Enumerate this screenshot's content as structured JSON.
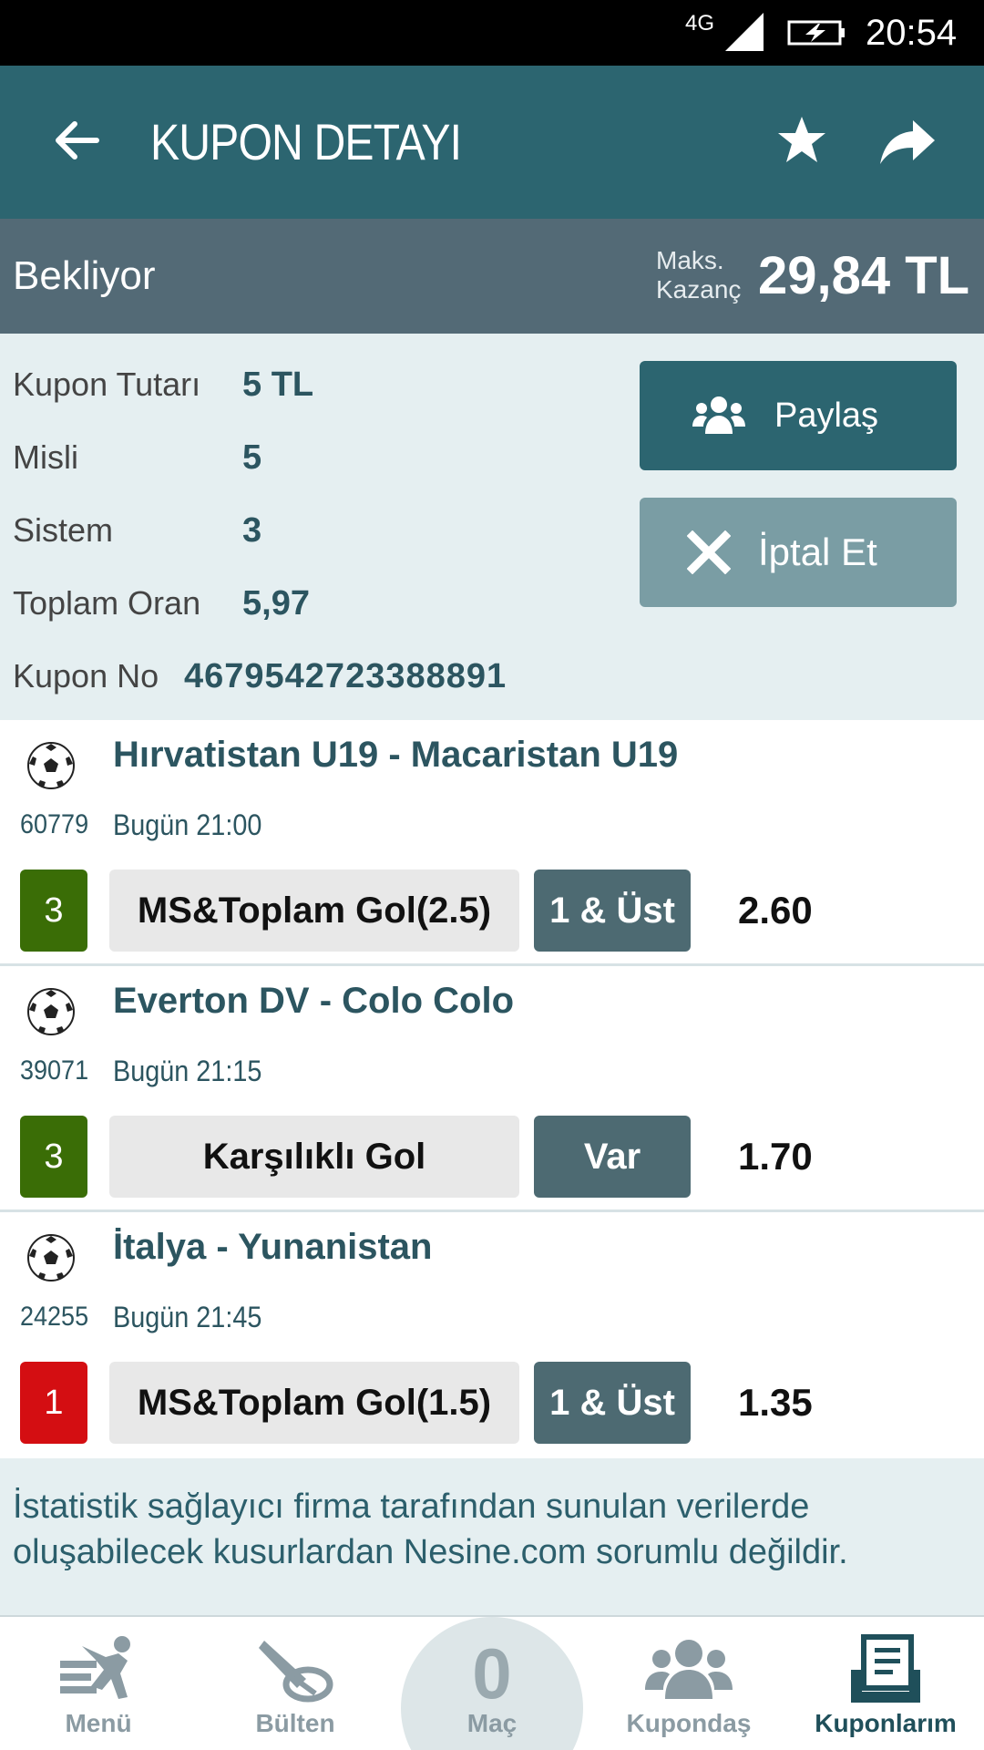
{
  "status_bar": {
    "network": "4G",
    "time": "20:54"
  },
  "app_bar": {
    "title": "KUPON DETAYI"
  },
  "coupon_status": {
    "label": "Bekliyor",
    "max_win_label_1": "Maks.",
    "max_win_label_2": "Kazanç",
    "max_win_value": "29,84 TL"
  },
  "info": {
    "rows": [
      {
        "key": "Kupon Tutarı",
        "value": "5 TL"
      },
      {
        "key": "Misli",
        "value": "5"
      },
      {
        "key": "Sistem",
        "value": "3"
      },
      {
        "key": "Toplam Oran",
        "value": "5,97"
      }
    ],
    "kupon_no_label": "Kupon No",
    "kupon_no_value": "4679542723388891"
  },
  "actions": {
    "share_label": "Paylaş",
    "cancel_label": "İptal Et"
  },
  "matches": [
    {
      "title": "Hırvatistan U19 - Macaristan U19",
      "code": "60779",
      "time": "Bugün 21:00",
      "badge": "3",
      "badge_color": "#3a6d06",
      "market": "MS&Toplam Gol(2.5)",
      "pick": "1 & Üst",
      "odds": "2.60"
    },
    {
      "title": "Everton DV - Colo Colo",
      "code": "39071",
      "time": "Bugün 21:15",
      "badge": "3",
      "badge_color": "#3a6d06",
      "market": "Karşılıklı Gol",
      "pick": "Var",
      "odds": "1.70"
    },
    {
      "title": "İtalya - Yunanistan",
      "code": "24255",
      "time": "Bugün 21:45",
      "badge": "1",
      "badge_color": "#d40e12",
      "market": "MS&Toplam Gol(1.5)",
      "pick": "1 & Üst",
      "odds": "1.35"
    }
  ],
  "disclaimer": "İstatistik sağlayıcı firma tarafından sunulan verilerde oluşabilecek kusurlardan Nesine.com sorumlu değildir.",
  "bottom_nav": {
    "menu": "Menü",
    "bulten": "Bülten",
    "mac_count": "0",
    "mac": "Maç",
    "kupondas": "Kupondaş",
    "kuponlarim": "Kuponlarım"
  },
  "colors": {
    "primary": "#2c6570",
    "status_bar": "#536a76",
    "panel": "#e5eff1"
  }
}
